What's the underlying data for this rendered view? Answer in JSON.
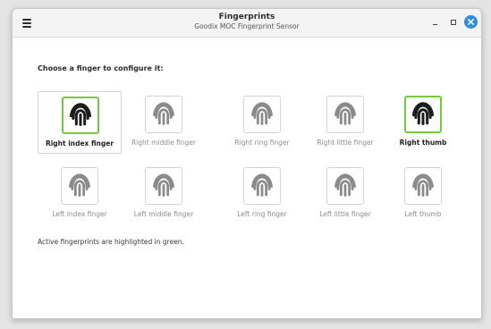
{
  "window": {
    "title": "Fingerprints",
    "subtitle": "Goodix MOC Fingerprint Sensor"
  },
  "controls": {
    "menu_icon": "hamburger-icon",
    "minimize_icon": "minimize-icon",
    "maximize_icon": "maximize-icon",
    "close_icon": "close-icon"
  },
  "prompt": "Choose a finger to configure it:",
  "fingers": [
    {
      "label": "Right index finger",
      "enrolled": true,
      "selected": true
    },
    {
      "label": "Right middle finger",
      "enrolled": false,
      "selected": false
    },
    {
      "label": "Right ring finger",
      "enrolled": false,
      "selected": false
    },
    {
      "label": "Right little finger",
      "enrolled": false,
      "selected": false
    },
    {
      "label": "Right thumb",
      "enrolled": true,
      "selected": false
    },
    {
      "label": "Left index finger",
      "enrolled": false,
      "selected": false
    },
    {
      "label": "Left middle finger",
      "enrolled": false,
      "selected": false
    },
    {
      "label": "Left ring finger",
      "enrolled": false,
      "selected": false
    },
    {
      "label": "Left little finger",
      "enrolled": false,
      "selected": false
    },
    {
      "label": "Left thumb",
      "enrolled": false,
      "selected": false
    }
  ],
  "status_text": "Active fingerprints are highlighted in green.",
  "colors": {
    "active_border": "#73cc39",
    "active_icon": "#1c1c1c",
    "inactive_icon": "#8a8a8a",
    "close_button": "#2f8de4"
  }
}
